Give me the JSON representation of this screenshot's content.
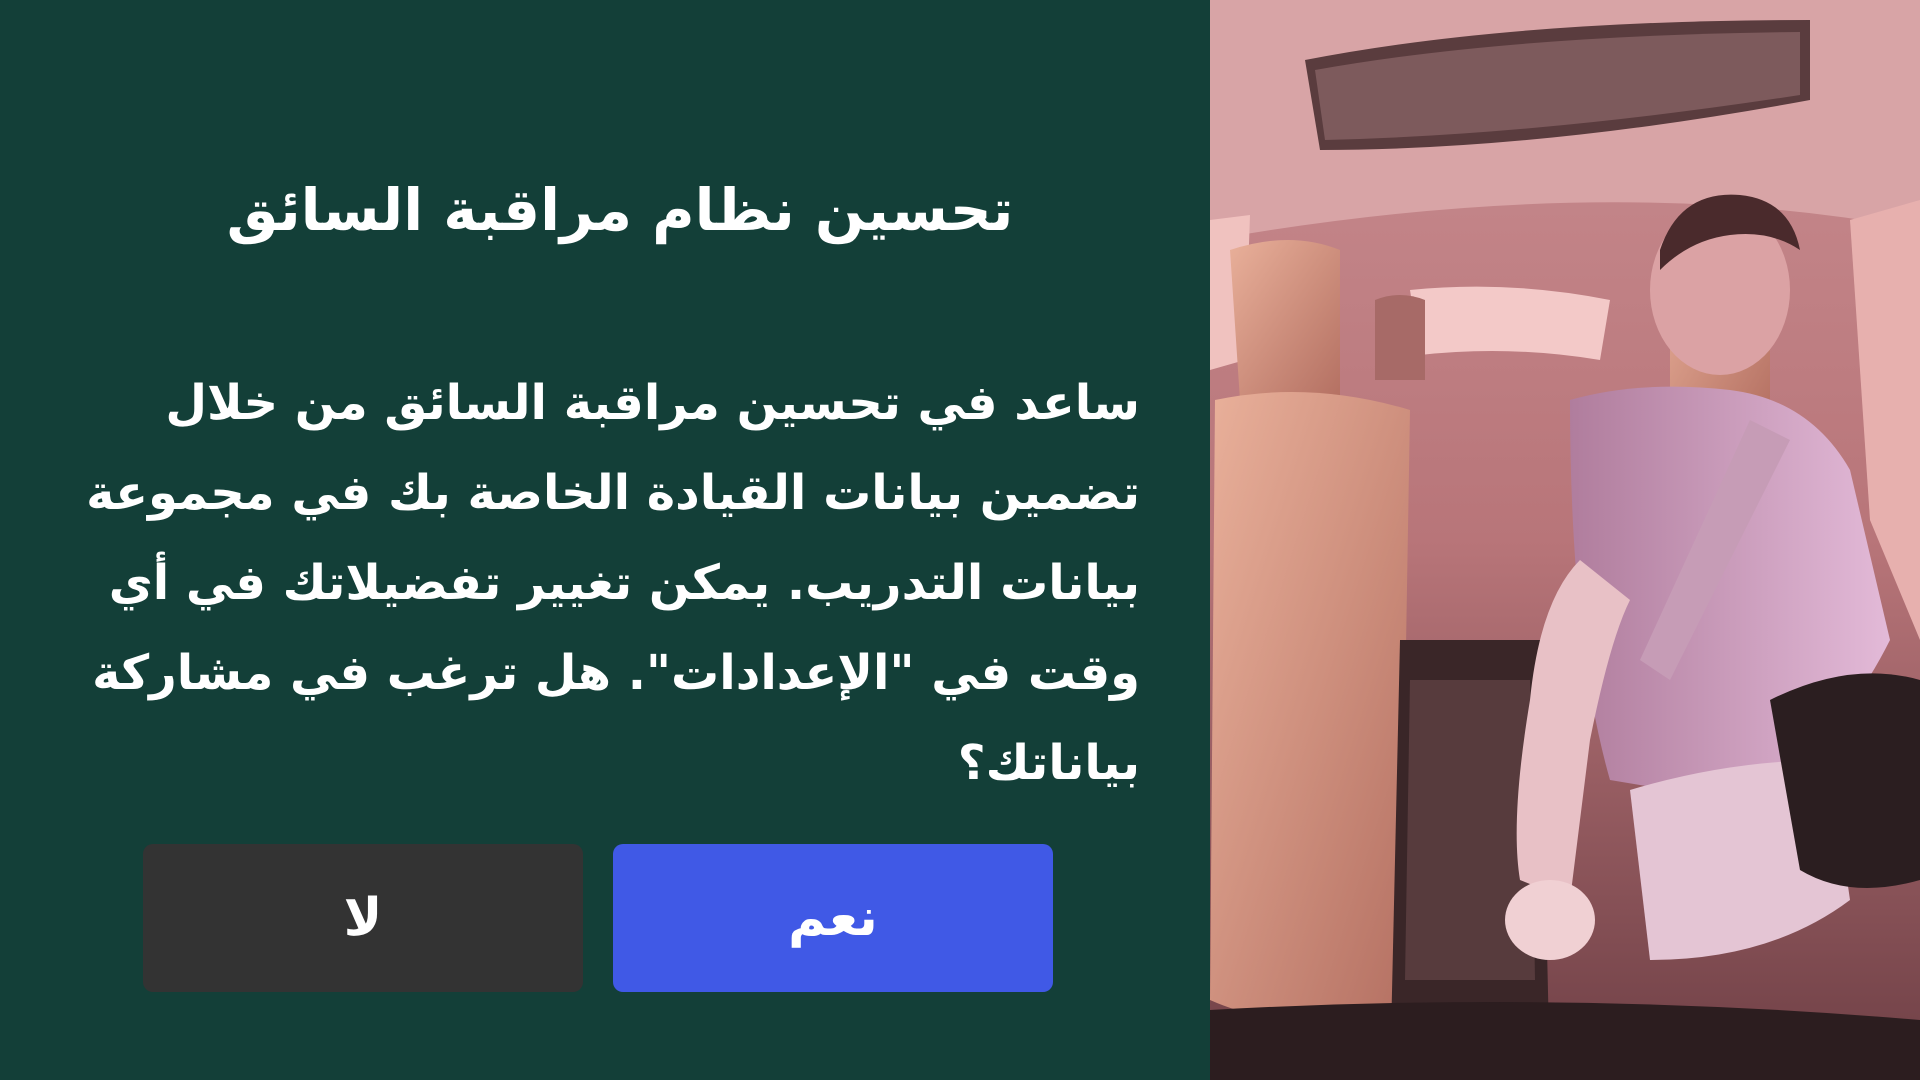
{
  "dialog": {
    "title": "تحسين نظام مراقبة السائق",
    "message": "ساعد في تحسين مراقبة السائق من خلال تضمين بيانات القيادة الخاصة بك في مجموعة بيانات التدريب. يمكن تغيير تفضيلاتك في أي وقت في \"الإعدادات\". هل ترغب في مشاركة بياناتك؟",
    "no_label": "لا",
    "yes_label": "نعم"
  },
  "colors": {
    "panel_background": "#133f38",
    "no_button": "#333333",
    "yes_button": "#4059e6",
    "text": "#ffffff"
  },
  "camera_feed": {
    "icon": "driver-camera-image"
  }
}
